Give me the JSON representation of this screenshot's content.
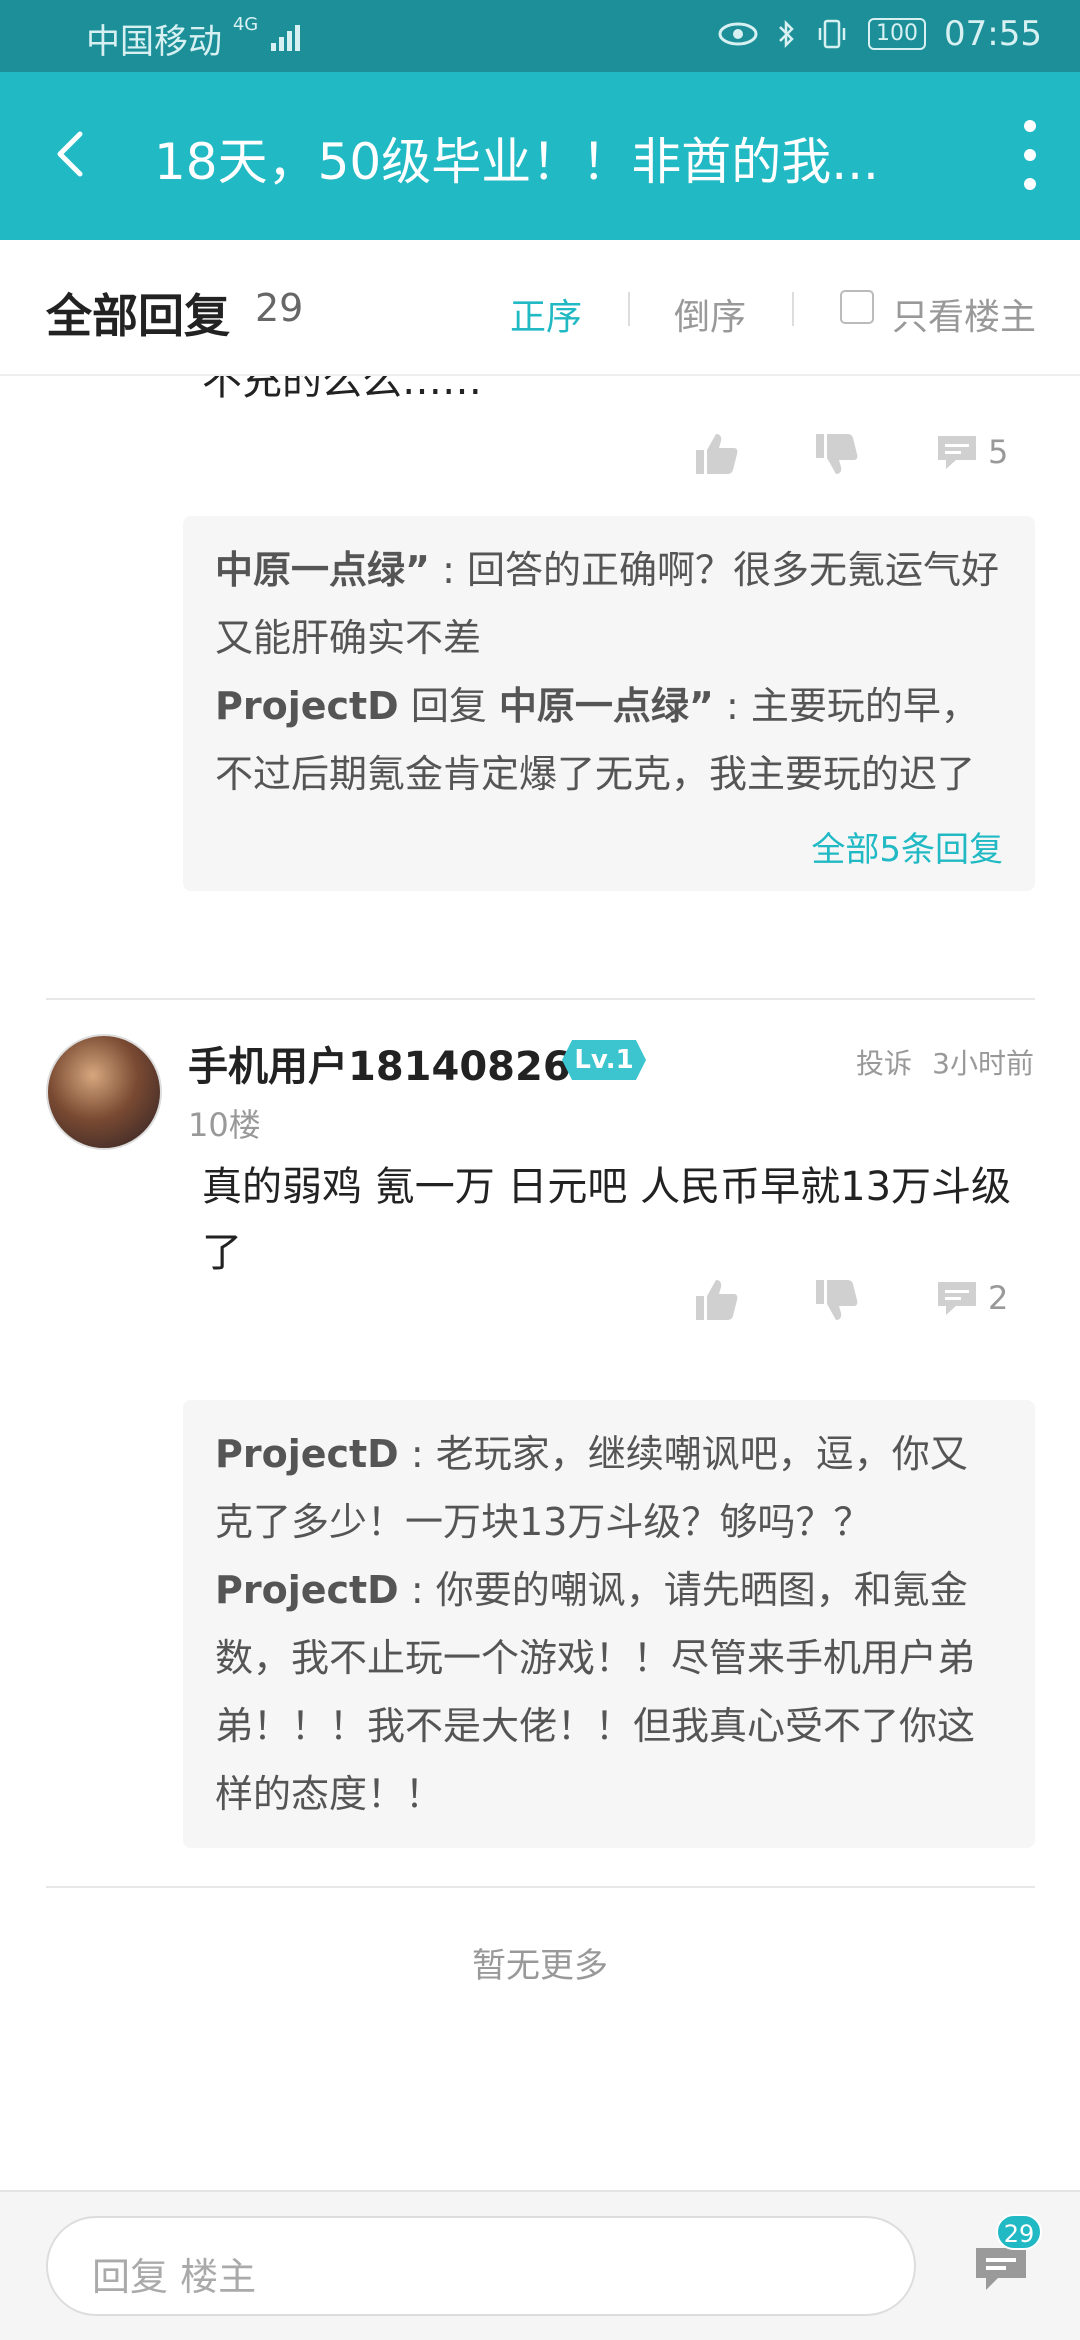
{
  "status": {
    "carrier": "中国移动",
    "network": "4G",
    "battery": "100",
    "time": "07:55"
  },
  "header": {
    "title": "18天，50级毕业！！非酋的我..."
  },
  "sort": {
    "label": "全部回复",
    "count": "29",
    "asc": "正序",
    "desc": "倒序",
    "only_op": "只看楼主"
  },
  "prev_post": {
    "cut_text": "不充的么么……",
    "comment_count": "5",
    "replies": [
      {
        "user": "中原一点绿”",
        "sep": " : ",
        "text": "回答的正确啊？很多无氪运气好又能肝确实不差"
      },
      {
        "user": "ProjectD",
        "verb": " 回复 ",
        "target": "中原一点绿”",
        "sep": " : ",
        "text": "主要玩的早，不过后期氪金肯定爆了无克，我主要玩的迟了"
      }
    ],
    "more_replies": "全部5条回复"
  },
  "post": {
    "username": "手机用户18140826",
    "level": "Lv.1",
    "floor": "10楼",
    "report": "投诉",
    "time": "3小时前",
    "text": "真的弱鸡 氪一万 日元吧 人民币早就13万斗级了",
    "comment_count": "2",
    "replies": [
      {
        "user": "ProjectD",
        "sep": " : ",
        "text": "老玩家，继续嘲讽吧，逗，你又克了多少！一万块13万斗级？够吗？？"
      },
      {
        "user": "ProjectD",
        "sep": " : ",
        "text": "你要的嘲讽，请先晒图，和氪金数，我不止玩一个游戏！！尽管来手机用户弟弟！！！我不是大佬！！但我真心受不了你这样的态度！！"
      }
    ]
  },
  "footer": {
    "no_more": "暂无更多"
  },
  "bottom": {
    "placeholder": "回复  楼主",
    "badge": "29"
  },
  "colors": {
    "accent": "#20b9c4",
    "status_bar": "#1d8f98"
  }
}
